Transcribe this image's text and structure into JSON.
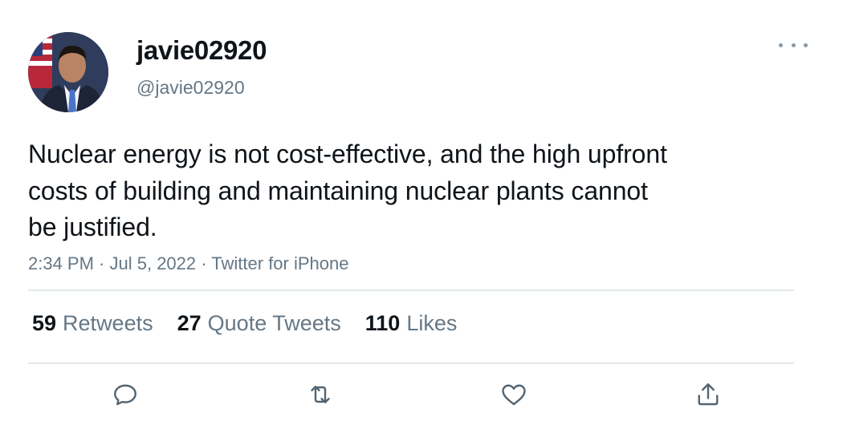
{
  "user": {
    "display_name": "javie02920",
    "handle": "@javie02920"
  },
  "tweet": {
    "text": "Nuclear energy is not cost-effective, and the high upfront costs of building and maintaining nuclear plants cannot be justified.",
    "time": "2:34 PM",
    "separator": " · ",
    "date": "Jul 5, 2022",
    "source": "Twitter for iPhone"
  },
  "stats": {
    "retweets_count": "59",
    "retweets_label": "Retweets",
    "quotes_count": "27",
    "quotes_label": "Quote Tweets",
    "likes_count": "110",
    "likes_label": "Likes"
  },
  "icons": {
    "more": "more-horizontal-icon",
    "reply": "reply-icon",
    "retweet": "retweet-icon",
    "like": "heart-icon",
    "share": "share-icon"
  },
  "colors": {
    "text": "#0f1419",
    "secondary": "#657786",
    "divider": "#e1e8ed"
  }
}
